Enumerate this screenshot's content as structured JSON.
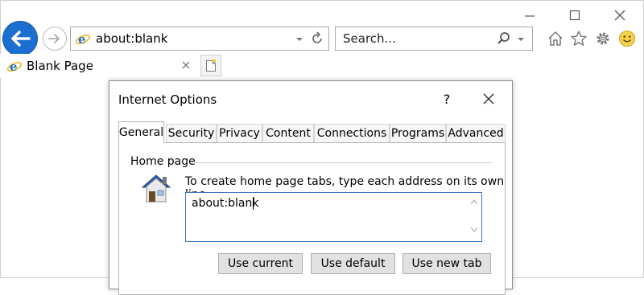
{
  "browser": {
    "address": "about:blank",
    "search_placeholder": "Search...",
    "tab_title": "Blank Page"
  },
  "dialog": {
    "title": "Internet Options",
    "help_label": "?",
    "tabs": [
      "General",
      "Security",
      "Privacy",
      "Content",
      "Connections",
      "Programs",
      "Advanced"
    ],
    "active_tab": "General",
    "home_page": {
      "group_label": "Home page",
      "instruction": "To create home page tabs, type each address on its own line.",
      "value": "about:blank"
    },
    "buttons": {
      "use_current": "Use current",
      "use_default": "Use default",
      "use_new_tab": "Use new tab"
    }
  },
  "colors": {
    "accent_blue": "#1c6fd1",
    "focus_border": "#3b79c4",
    "button_face": "#e1e1e1"
  },
  "icons": [
    "minimize-icon",
    "maximize-icon",
    "close-icon",
    "back-arrow-icon",
    "forward-arrow-icon",
    "ie-logo-icon",
    "dropdown-icon",
    "refresh-icon",
    "search-icon",
    "home-icon",
    "favorites-star-icon",
    "gear-icon",
    "smiley-icon",
    "new-tab-icon",
    "house-icon"
  ]
}
